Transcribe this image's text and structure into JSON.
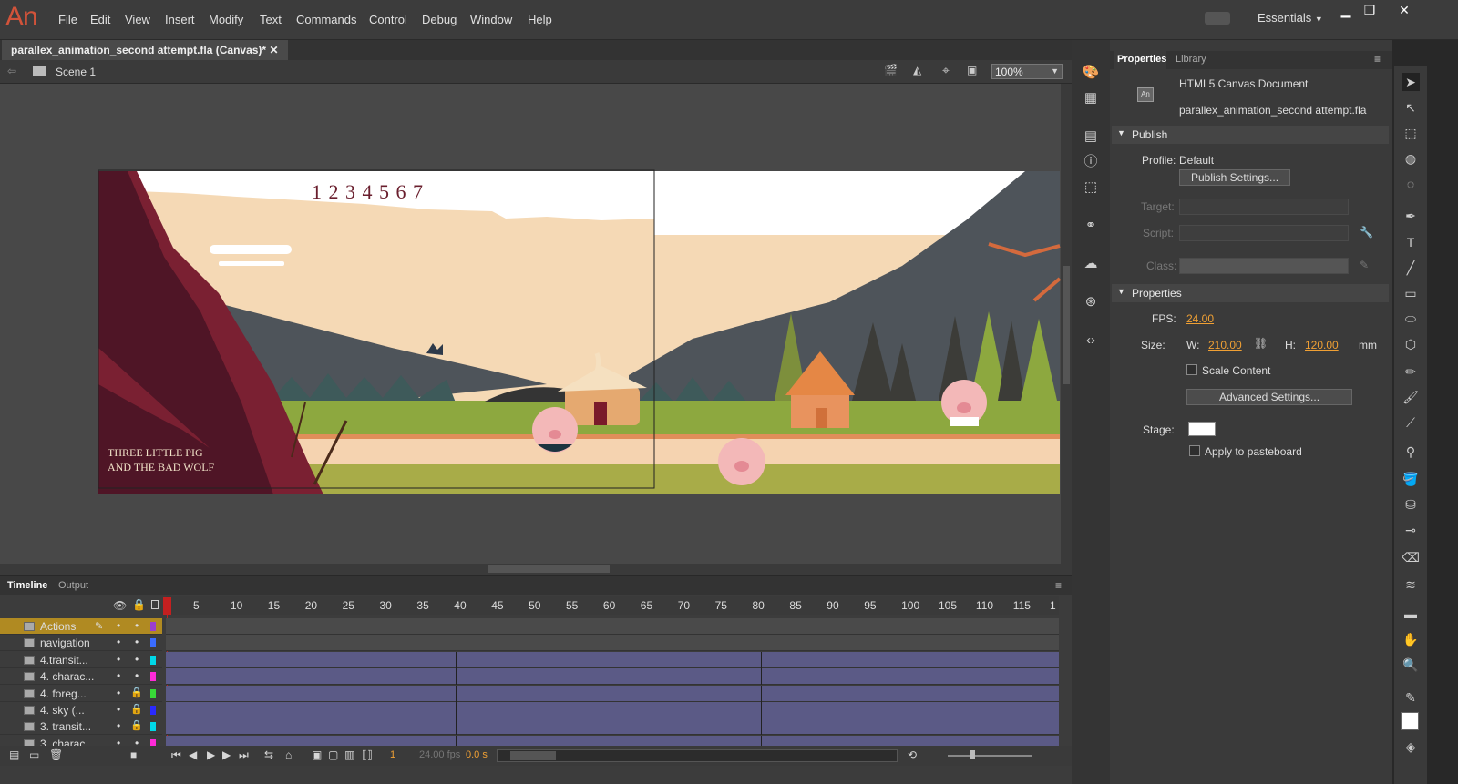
{
  "app": {
    "logo": "An"
  },
  "menu": [
    "File",
    "Edit",
    "View",
    "Insert",
    "Modify",
    "Text",
    "Commands",
    "Control",
    "Debug",
    "Window",
    "Help"
  ],
  "workspace": "Essentials",
  "document": {
    "tab": "parallex_animation_second attempt.fla (Canvas)*"
  },
  "scene": {
    "name": "Scene 1",
    "zoom": "100%"
  },
  "stage": {
    "counter": "1 2 3 4 5 6 7",
    "title_line1": "THREE LITTLE PIG",
    "title_line2": "AND THE BAD WOLF"
  },
  "timeline": {
    "tabs": [
      "Timeline",
      "Output"
    ],
    "ruler": [
      "1",
      "5",
      "10",
      "15",
      "20",
      "25",
      "30",
      "35",
      "40",
      "45",
      "50",
      "55",
      "60",
      "65",
      "70",
      "75",
      "80",
      "85",
      "90",
      "95",
      "100",
      "105",
      "110",
      "115",
      "1"
    ],
    "layers": [
      {
        "name": "Actions",
        "color": "#9b3fcf",
        "locked": false
      },
      {
        "name": "navigation",
        "color": "#3a6cff",
        "locked": false
      },
      {
        "name": "4.transit...",
        "color": "#00d8e8",
        "locked": false
      },
      {
        "name": "4. charac...",
        "color": "#ff2ad8",
        "locked": false
      },
      {
        "name": "4. foreg...",
        "color": "#38d838",
        "locked": true
      },
      {
        "name": "4. sky (...",
        "color": "#2a2aff",
        "locked": true
      },
      {
        "name": "3. transit...",
        "color": "#00d8e8",
        "locked": true
      },
      {
        "name": "3. charac...",
        "color": "#ff2ad8",
        "locked": false
      }
    ],
    "current_frame": "1",
    "fps": "24.00 fps",
    "time": "0.0 s"
  },
  "panel": {
    "tabs": [
      "Properties",
      "Library"
    ],
    "doc_type": "HTML5 Canvas Document",
    "doc_icon": "An",
    "filename": "parallex_animation_second attempt.fla",
    "publish_header": "Publish",
    "profile_label": "Profile:",
    "profile_value": "Default",
    "publish_settings": "Publish Settings...",
    "target_label": "Target:",
    "script_label": "Script:",
    "class_label": "Class:",
    "properties_header": "Properties",
    "fps_label": "FPS:",
    "fps_value": "24.00",
    "size_label": "Size:",
    "w_label": "W:",
    "w_value": "210.00",
    "h_label": "H:",
    "h_value": "120.00",
    "unit": "mm",
    "scale_content": "Scale Content",
    "advanced_settings": "Advanced Settings...",
    "stage_label": "Stage:",
    "pasteboard": "Apply to pasteboard"
  },
  "colors": {
    "accent": "#f0a034",
    "stage_bg": "#ffffff",
    "logo": "#d2533a"
  }
}
